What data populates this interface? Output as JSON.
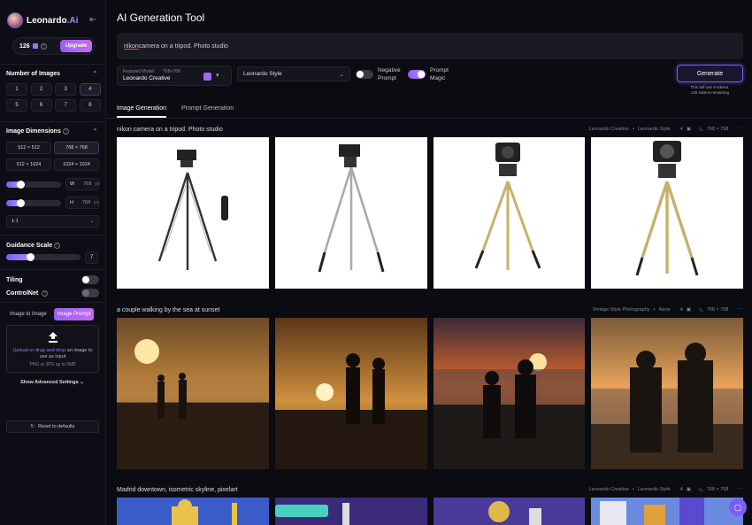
{
  "brand": {
    "name": "Leonardo",
    "suffix": ".Ai"
  },
  "account": {
    "tokens": "126",
    "upgrade_label": "Upgrade"
  },
  "sidebar": {
    "num_images_title": "Number of Images",
    "num_images": [
      "1",
      "2",
      "3",
      "4",
      "5",
      "6",
      "7",
      "8"
    ],
    "num_images_selected": "4",
    "dimensions_title": "Image Dimensions",
    "dimensions": [
      "512 × 512",
      "768 × 768",
      "512 × 1024",
      "1024 × 1024"
    ],
    "dimensions_selected": "768 × 768",
    "width": {
      "key": "W",
      "value": "768",
      "unit": "px"
    },
    "height": {
      "key": "H",
      "value": "768",
      "unit": "px"
    },
    "aspect_ratio": "1:1",
    "guidance_title": "Guidance Scale",
    "guidance_value": "7",
    "tiling_label": "Tiling",
    "controlnet_label": "ControlNet",
    "image_tabs": [
      "Image to Image",
      "Image Prompt"
    ],
    "upload_link": "Upload or drag and drop",
    "upload_text": "an image to use as input",
    "upload_hint": "PNG or JPG up to 5MB",
    "advanced_label": "Show Advanced Settings",
    "reset_label": "Reset to defaults"
  },
  "main": {
    "title": "AI Generation Tool",
    "prompt": "nikon camera on a tripod. Photo studio",
    "prompt_first_word": "nikon",
    "prompt_rest": " camera on a tripod. Photo studio",
    "model_caption": "Featured Model",
    "model_size": "768×768",
    "model_name": "Leonardo Creative",
    "style": "Leonardo Style",
    "negative_prompt_label_1": "Negative",
    "negative_prompt_label_2": "Prompt",
    "prompt_magic_label_1": "Prompt",
    "prompt_magic_label_2": "Magic",
    "generate_label": "Generate",
    "generate_note_1": "This will use 8 tokens.",
    "generate_note_2": "126 tokens remaining",
    "tabs": [
      "Image Generation",
      "Prompt Generation"
    ]
  },
  "generations": [
    {
      "prompt": "nikon camera on a tripod. Photo studio",
      "model": "Leonardo Creative",
      "style": "Leonardo Style",
      "count": "4",
      "size": "768 × 768"
    },
    {
      "prompt": "a couple walking by the sea at sunset",
      "model": "Vintage Style Photography",
      "style": "None",
      "count": "4",
      "size": "768 × 768"
    },
    {
      "prompt": "Madrid downtown, isometric skyline, pixelart",
      "model": "Leonardo Creative",
      "style": "Leonardo Style",
      "count": "4",
      "size": "768 × 768"
    }
  ],
  "colors": {
    "accent": "#8b5cf6",
    "background": "#0b0b12",
    "panel": "#15151f"
  }
}
